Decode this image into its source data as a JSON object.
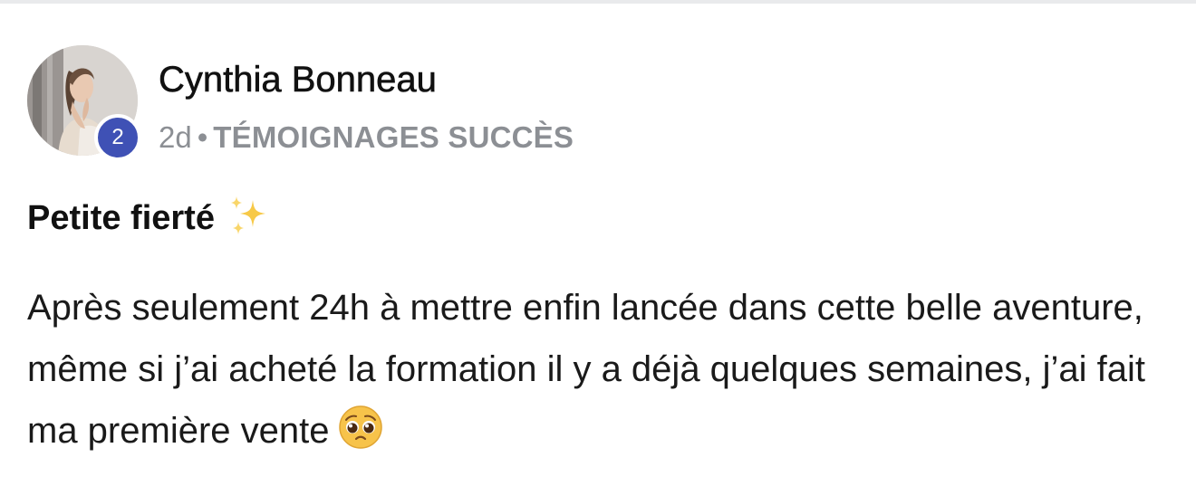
{
  "post": {
    "author": {
      "name": "Cynthia Bonneau",
      "level": "2",
      "avatar_icon": "profile-photo"
    },
    "meta": {
      "time_ago": "2d",
      "separator": "•",
      "category": "TÉMOIGNAGES SUCCÈS"
    },
    "title": "Petite fierté",
    "title_icon": "sparkles-emoji",
    "body": "Après seulement 24h à mettre enfin lancée dans cette belle aventure, même si j’ai acheté la formation il y a déjà quelques semaines, j’ai fait ma première vente",
    "body_icon": "pleading-face-emoji"
  },
  "colors": {
    "level_badge": "#3f51b5",
    "meta_text": "#8c8f94",
    "text": "#111111"
  }
}
